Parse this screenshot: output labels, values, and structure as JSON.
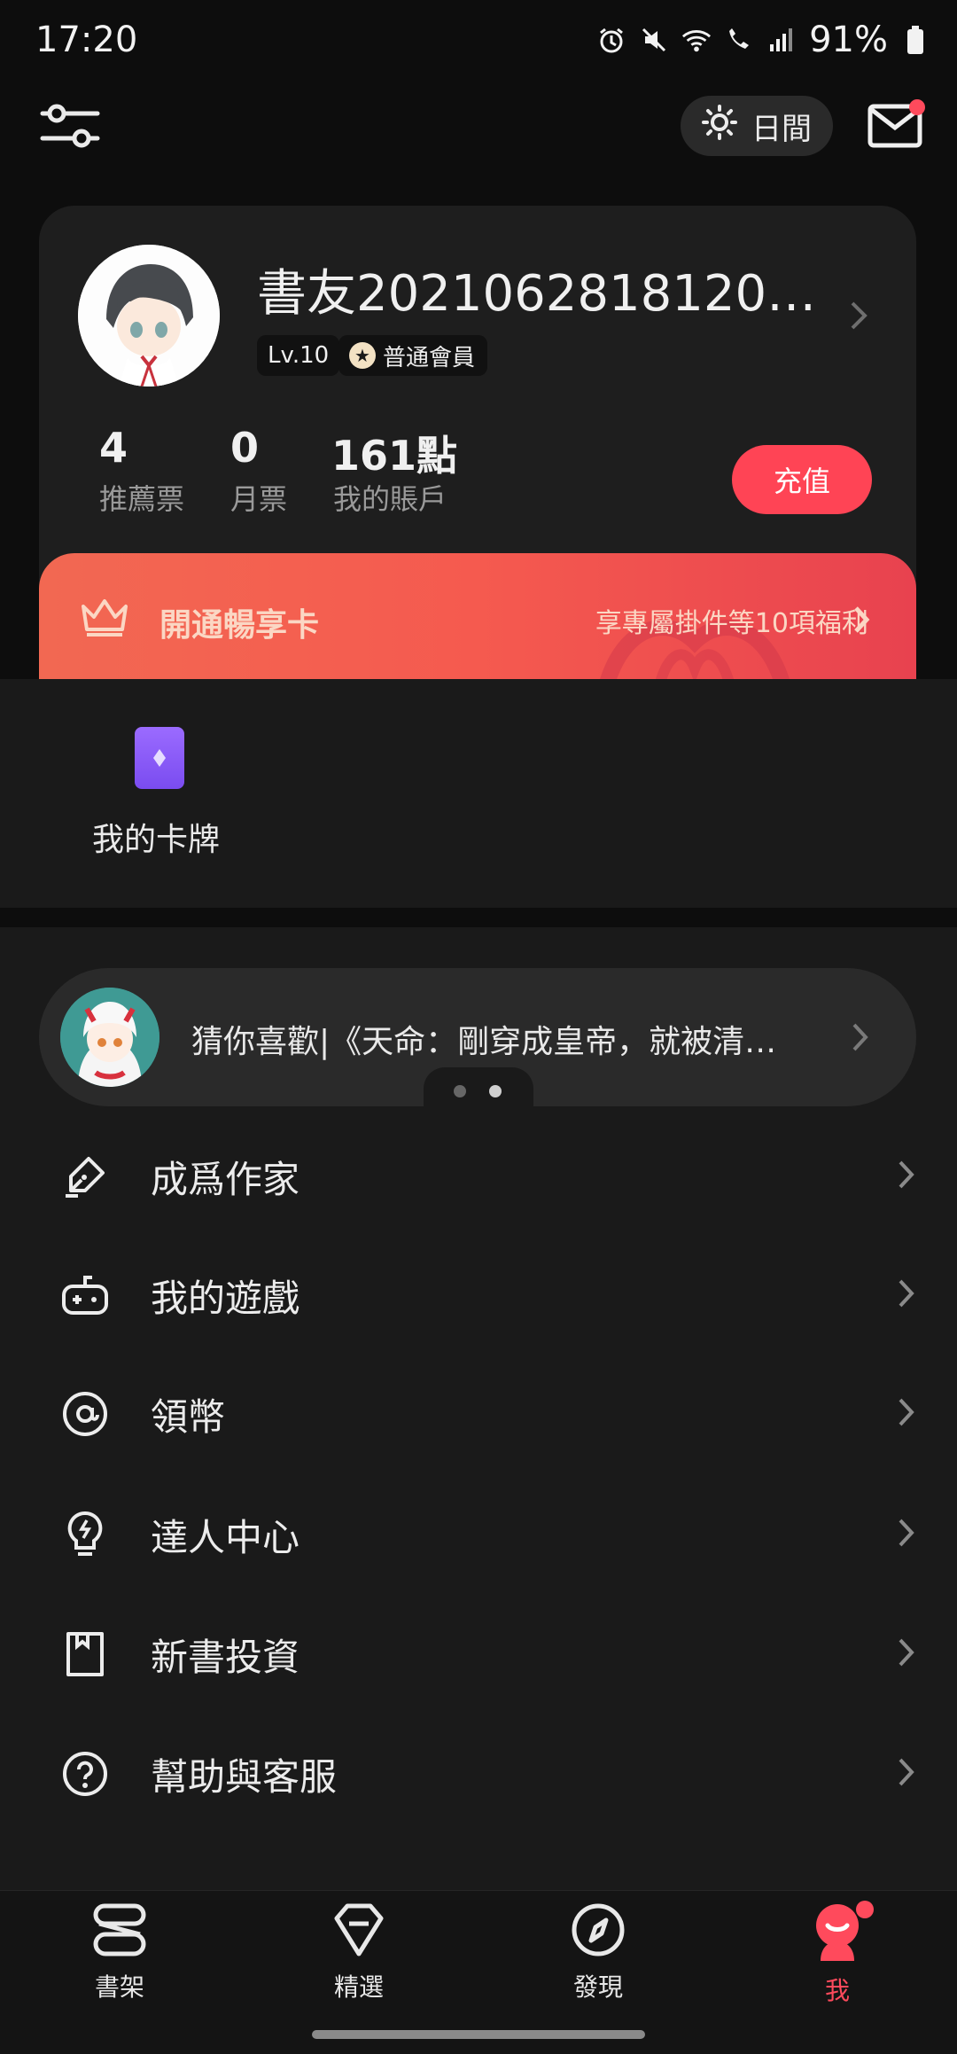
{
  "status_bar": {
    "time": "17:20",
    "battery": "91%"
  },
  "header": {
    "theme_label": "日間"
  },
  "profile": {
    "username": "書友2021062818120…",
    "level": "Lv.10",
    "membership": "普通會員",
    "stats": [
      {
        "value": "4",
        "label": "推薦票"
      },
      {
        "value": "0",
        "label": "月票"
      },
      {
        "value": "161點",
        "label": "我的賬戶"
      }
    ],
    "recharge_label": "充值"
  },
  "vip_banner": {
    "title": "開通暢享卡",
    "subtitle": "享專屬掛件等10項福利"
  },
  "cards": {
    "label": "我的卡牌"
  },
  "recommendation": {
    "text": "猜你喜歡|《天命：剛穿成皇帝，就被清…"
  },
  "menu": [
    {
      "label": "成爲作家",
      "icon": "pen-icon"
    },
    {
      "label": "我的遊戲",
      "icon": "gamepad-icon"
    },
    {
      "label": "領幣",
      "icon": "at-coin-icon"
    },
    {
      "label": "達人中心",
      "icon": "lightbulb-icon"
    },
    {
      "label": "新書投資",
      "icon": "bookmark-page-icon"
    },
    {
      "label": "幫助與客服",
      "icon": "help-icon"
    }
  ],
  "tabs": [
    {
      "label": "書架",
      "active": false
    },
    {
      "label": "精選",
      "active": false
    },
    {
      "label": "發現",
      "active": false
    },
    {
      "label": "我",
      "active": true
    }
  ],
  "colors": {
    "accent": "#ff4455",
    "background": "#0d0d0d",
    "panel": "#1a1a1a"
  }
}
